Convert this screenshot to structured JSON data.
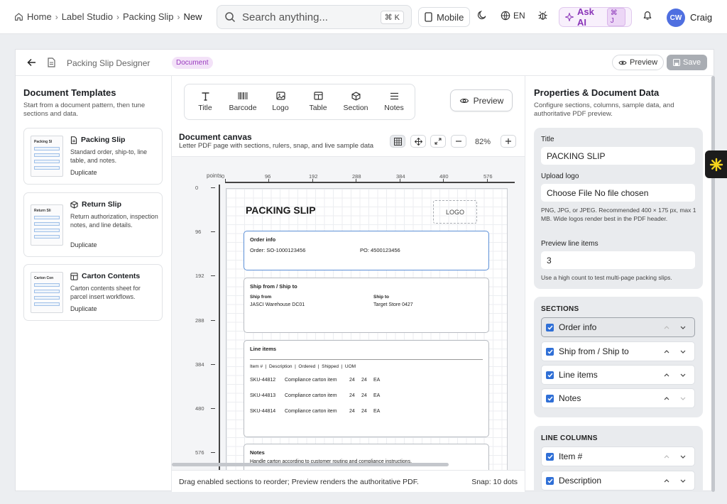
{
  "breadcrumbs": [
    {
      "label": "Home"
    },
    {
      "label": "Label Studio"
    },
    {
      "label": "Packing Slip"
    },
    {
      "label": "New"
    }
  ],
  "search": {
    "placeholder": "Search anything...",
    "shortcut": "⌘ K"
  },
  "topbar": {
    "mobile_label": "Mobile",
    "lang": "EN",
    "ask_ai": "Ask AI",
    "ask_ai_shortcut": "⌘ J",
    "avatar_initials": "CW",
    "user_name": "Craig"
  },
  "app": {
    "title": "Packing Slip Designer",
    "badge": "Document",
    "preview_label": "Preview",
    "save_label": "Save"
  },
  "templates": {
    "title": "Document Templates",
    "subtitle": "Start from a document pattern, then tune sections and data.",
    "items": [
      {
        "name": "Packing Slip",
        "thumb": "Packing Sl",
        "desc": "Standard order, ship-to, line table, and notes.",
        "action": "Duplicate"
      },
      {
        "name": "Return Slip",
        "thumb": "Return Sli",
        "desc": "Return authorization, inspection notes, and line details.",
        "action": "Duplicate"
      },
      {
        "name": "Carton Contents",
        "thumb": "Carton Con",
        "desc": "Carton contents sheet for parcel insert workflows.",
        "action": "Duplicate"
      }
    ]
  },
  "tools": [
    {
      "label": "Title",
      "icon": "type-icon"
    },
    {
      "label": "Barcode",
      "icon": "barcode-icon"
    },
    {
      "label": "Logo",
      "icon": "image-icon"
    },
    {
      "label": "Table",
      "icon": "table-icon"
    },
    {
      "label": "Section",
      "icon": "cube-icon"
    },
    {
      "label": "Notes",
      "icon": "menu-icon"
    }
  ],
  "canvas": {
    "preview_label": "Preview",
    "title": "Document canvas",
    "subtitle": "Letter PDF page with sections, rulers, snap, and live sample data",
    "zoom": "82%",
    "ruler_unit": "points",
    "top_ticks": [
      "0",
      "96",
      "192",
      "288",
      "384",
      "480",
      "576"
    ],
    "left_ticks": [
      "0",
      "96",
      "192",
      "288",
      "384",
      "480",
      "576"
    ],
    "status": "Drag enabled sections to reorder; Preview renders the authoritative PDF.",
    "snap": "Snap: 10 dots"
  },
  "document": {
    "title": "PACKING SLIP",
    "logo": "LOGO",
    "order": {
      "heading": "Order info",
      "order_no": "Order: SO-1000123456",
      "po": "PO: 4500123456"
    },
    "ship": {
      "heading": "Ship from / Ship to",
      "from_label": "Ship from",
      "from_value": "JASCI Warehouse DC01",
      "to_label": "Ship to",
      "to_value": "Target Store 0427"
    },
    "lines": {
      "heading": "Line items",
      "columns": "Item #  |  Description  |  Ordered  |  Shipped  |  UOM",
      "rows": [
        [
          "SKU-44812",
          "Compliance carton item",
          "24",
          "24",
          "EA"
        ],
        [
          "SKU-44813",
          "Compliance carton item",
          "24",
          "24",
          "EA"
        ],
        [
          "SKU-44814",
          "Compliance carton item",
          "24",
          "24",
          "EA"
        ]
      ]
    },
    "notes": {
      "heading": "Notes",
      "text": "Handle carton according to customer routing and compliance instructions."
    }
  },
  "properties": {
    "title": "Properties & Document Data",
    "subtitle": "Configure sections, columns, sample data, and authoritative PDF preview.",
    "title_label": "Title",
    "title_value": "PACKING SLIP",
    "logo_label": "Upload logo",
    "logo_value": "Choose File No file chosen",
    "logo_help": "PNG, JPG, or JPEG. Recommended 400 × 175 px, max 1 MB. Wide logos render best in the PDF header.",
    "lines_label": "Preview line items",
    "lines_value": "3",
    "lines_help": "Use a high count to test multi-page packing slips.",
    "sections_heading": "SECTIONS",
    "sections": [
      {
        "label": "Order info",
        "checked": true
      },
      {
        "label": "Ship from / Ship to",
        "checked": true
      },
      {
        "label": "Line items",
        "checked": true
      },
      {
        "label": "Notes",
        "checked": true
      }
    ],
    "columns_heading": "LINE COLUMNS",
    "columns": [
      {
        "label": "Item #",
        "checked": true
      },
      {
        "label": "Description",
        "checked": true
      }
    ]
  },
  "colors": {
    "accent": "#2f6fd6",
    "ai": "#8a35b8",
    "badge": "#9a3bbf",
    "avatar": "#4f6fe0"
  }
}
